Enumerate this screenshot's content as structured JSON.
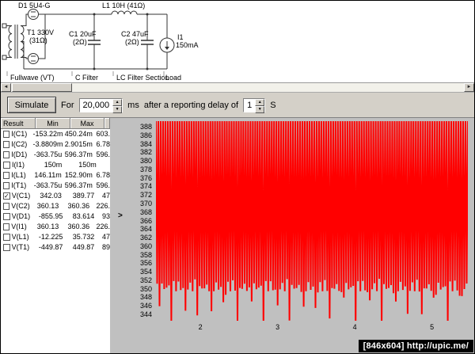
{
  "schematic": {
    "labels": {
      "d1": "D1 5U4-G",
      "t1_line1": "T1 330V",
      "t1_line2": "(31Ω)",
      "c1_line1": "C1 20uF",
      "c1_line2": "(2Ω)",
      "l1": "L1 10H (41Ω)",
      "c2_line1": "C2 47uF",
      "c2_line2": "(2Ω)",
      "i1_line1": "I1",
      "i1_line2": "150mA"
    },
    "sections": [
      "Fullwave (VT)",
      "C Filter",
      "LC Filter Section",
      "Load"
    ]
  },
  "toolbar": {
    "simulate_label": "Simulate",
    "for_label": "For",
    "duration_value": "20,000",
    "duration_unit": "ms",
    "delay_text": "after a reporting delay of",
    "delay_value": "1",
    "delay_unit": "S"
  },
  "results": {
    "columns": [
      "Result",
      "Min",
      "Max"
    ],
    "rows": [
      {
        "name": "I(C1)",
        "min": "-153.22m",
        "max": "450.24m",
        "extra": "603.",
        "checked": false
      },
      {
        "name": "I(C2)",
        "min": "-3.8809m",
        "max": "2.9015m",
        "extra": "6.78",
        "checked": false
      },
      {
        "name": "I(D1)",
        "min": "-363.75u",
        "max": "596.37m",
        "extra": "596.",
        "checked": false
      },
      {
        "name": "I(I1)",
        "min": "150m",
        "max": "150m",
        "extra": "",
        "checked": false
      },
      {
        "name": "I(L1)",
        "min": "146.11m",
        "max": "152.90m",
        "extra": "6.78",
        "checked": false
      },
      {
        "name": "I(T1)",
        "min": "-363.75u",
        "max": "596.37m",
        "extra": "596.",
        "checked": false
      },
      {
        "name": "V(C1)",
        "min": "342.03",
        "max": "389.77",
        "extra": "47",
        "checked": true
      },
      {
        "name": "V(C2)",
        "min": "360.13",
        "max": "360.36",
        "extra": "226.",
        "checked": false
      },
      {
        "name": "V(D1)",
        "min": "-855.95",
        "max": "83.614",
        "extra": "93",
        "checked": false
      },
      {
        "name": "V(I1)",
        "min": "360.13",
        "max": "360.36",
        "extra": "226.",
        "checked": false
      },
      {
        "name": "V(L1)",
        "min": "-12.225",
        "max": "35.732",
        "extra": "47",
        "checked": false
      },
      {
        "name": "V(T1)",
        "min": "-449.87",
        "max": "449.87",
        "extra": "89",
        "checked": false
      }
    ]
  },
  "chart_data": {
    "type": "area",
    "title": "",
    "xlabel": "",
    "ylabel": "",
    "series": [
      {
        "name": "V(C1)",
        "color": "#ff0000",
        "min": 342.03,
        "max": 389.77,
        "description": "dense full-wave rectifier ripple waveform, appears as near-solid red band between ~352V and ~390V with periodic dips to ~344V"
      }
    ],
    "x_ticks": [
      2,
      3,
      4,
      5
    ],
    "x_range": [
      1.42,
      5.46
    ],
    "y_ticks": [
      388,
      386,
      384,
      382,
      380,
      378,
      376,
      374,
      372,
      370,
      368,
      366,
      364,
      362,
      360,
      358,
      356,
      354,
      352,
      350,
      348,
      346,
      344
    ],
    "y_range": [
      342.6,
      389.4
    ],
    "marker_value": 367,
    "plot_bg": "#c0c0c0",
    "ripple": {
      "top": 389.7,
      "bottom_typical": 352.5,
      "bottom_deep": 344.0,
      "cycles": 132
    }
  },
  "watermark": "[846x604] http://upic.me/"
}
